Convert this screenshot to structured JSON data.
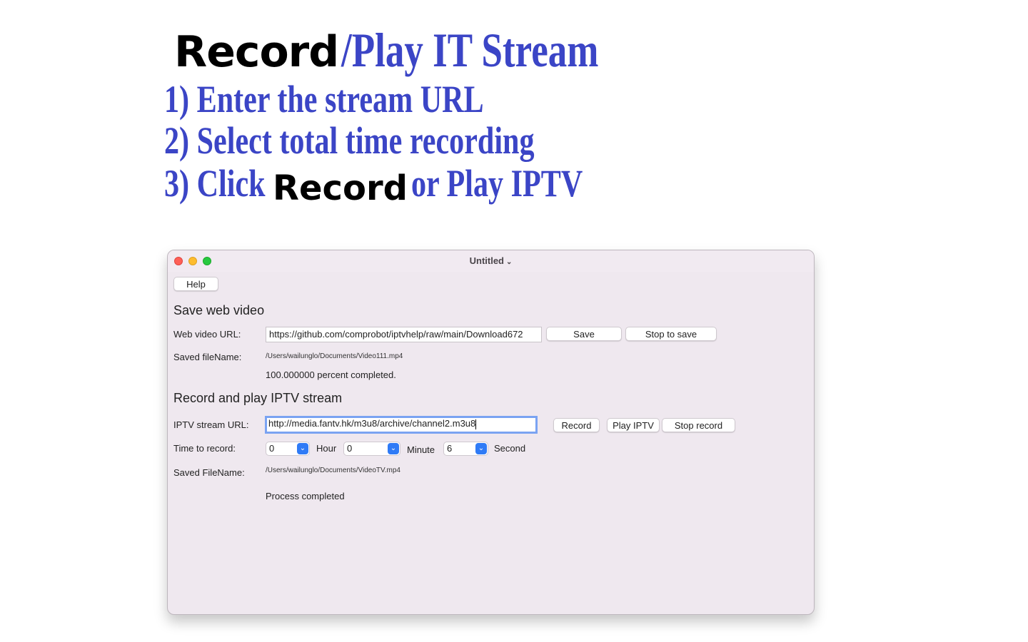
{
  "promo": {
    "title_black": "Record",
    "title_blue": "/Play IT Stream",
    "step1": "1) Enter the stream URL",
    "step2": "2) Select total time recording",
    "step3_prefix": "3) Click",
    "step3_record": "Record",
    "step3_suffix": "or Play IPTV"
  },
  "window": {
    "title": "Untitled",
    "help_label": "Help",
    "save_section": {
      "heading": "Save  web video",
      "url_label": "Web video URL:",
      "url_value": "https://github.com/comprobot/iptvhelp/raw/main/Download672",
      "save_label": "Save",
      "stop_label": "Stop to save",
      "filename_label": "Saved fileName:",
      "filename_value": "/Users/wailunglo/Documents/Video111.mp4",
      "progress_text": "100.000000  percent completed."
    },
    "iptv_section": {
      "heading": "Record  and play IPTV stream",
      "url_label": "IPTV stream URL:",
      "url_value": "http://media.fantv.hk/m3u8/archive/channel2.m3u8",
      "record_label": "Record",
      "play_label": "Play IPTV",
      "stop_label": "Stop record",
      "time_label": "Time to record:",
      "hour_value": "0",
      "hour_unit": "Hour",
      "minute_value": "0",
      "minute_unit": "Minute",
      "second_value": "6",
      "second_unit": "Second",
      "filename_label": "Saved FileName:",
      "filename_value": "/Users/wailunglo/Documents/VideoTV.mp4",
      "status_text": "Process completed"
    }
  },
  "colors": {
    "promo_blue": "#3b45c6",
    "window_bg": "#efe8ef",
    "select_accent": "#2f7bf6",
    "focus_ring": "#7aa3f2"
  }
}
